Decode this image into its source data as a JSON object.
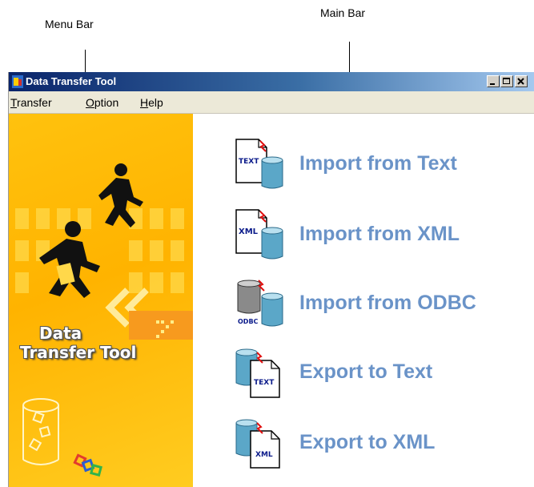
{
  "callouts": {
    "menu_bar": "Menu Bar",
    "main_bar": "Main Bar"
  },
  "window": {
    "title": "Data Transfer Tool",
    "controls": [
      "minimize",
      "maximize",
      "close"
    ]
  },
  "menu": {
    "items": [
      {
        "label": "Transfer",
        "mnemonic": "T"
      },
      {
        "label": "Option",
        "mnemonic": "O"
      },
      {
        "label": "Help",
        "mnemonic": "H"
      }
    ]
  },
  "banner": {
    "line1": "Data",
    "line2": "Transfer Tool"
  },
  "actions": [
    {
      "label": "Import from Text",
      "icon": "text-to-database-icon",
      "badge": "TEXT"
    },
    {
      "label": "Import from XML",
      "icon": "xml-to-database-icon",
      "badge": "XML"
    },
    {
      "label": "Import from ODBC",
      "icon": "odbc-to-database-icon",
      "badge": "ODBC"
    },
    {
      "label": "Export to Text",
      "icon": "database-to-text-icon",
      "badge": "TEXT"
    },
    {
      "label": "Export to XML",
      "icon": "database-to-xml-icon",
      "badge": "XML"
    }
  ],
  "colors": {
    "title_bar": "#0a246a",
    "action_text": "#6a93c8",
    "banner": "#ffb300",
    "menu_bg": "#ece9d8"
  }
}
